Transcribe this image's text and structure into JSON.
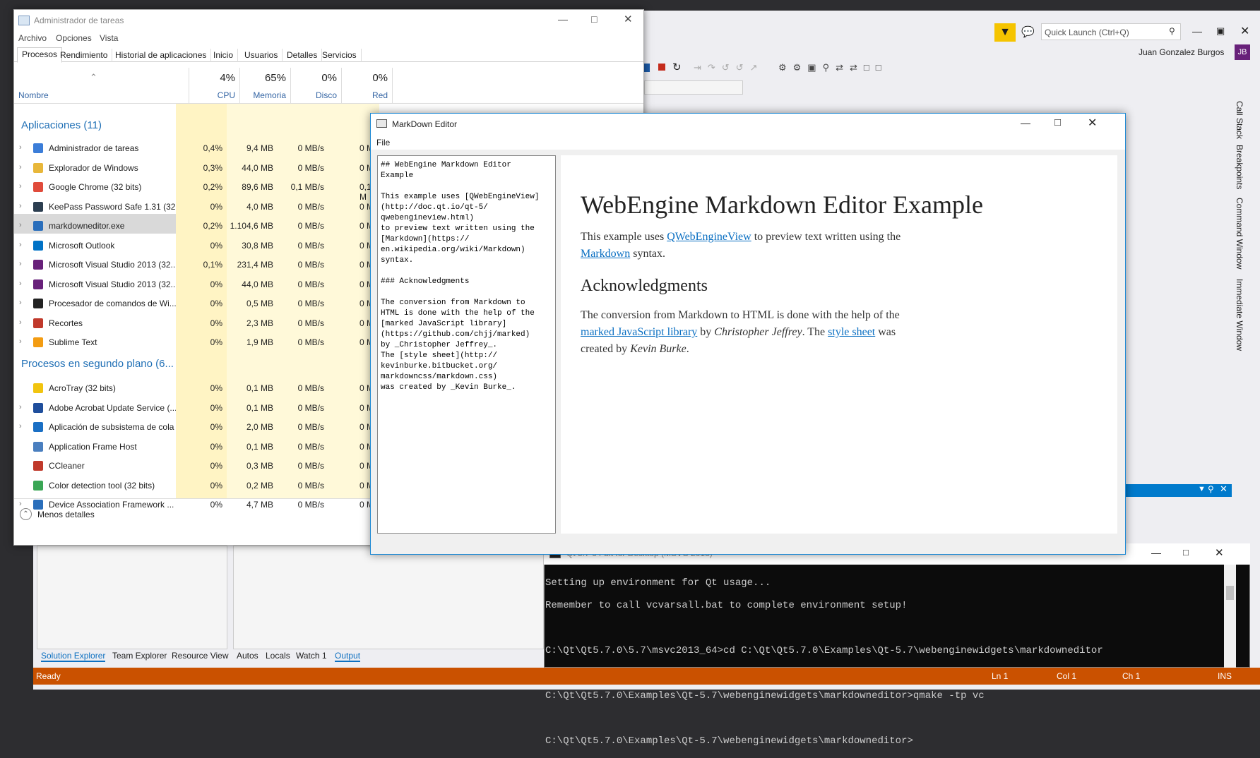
{
  "vs": {
    "quick_launch_placeholder": "Quick Launch (Ctrl+Q)",
    "user_name": "Juan Gonzalez Burgos",
    "user_initials": "JB",
    "right_tabs": [
      "Call Stack",
      "Breakpoints",
      "Command Window",
      "Immediate Window"
    ],
    "bottom_tabs_left": [
      "Solution Explorer",
      "Team Explorer",
      "Resource View"
    ],
    "bottom_tabs_right": [
      "Autos",
      "Locals",
      "Watch 1",
      "Output"
    ],
    "status": {
      "ready": "Ready",
      "ln": "Ln 1",
      "col": "Col 1",
      "ch": "Ch 1",
      "ins": "INS"
    },
    "colors": {
      "status_bar": "#ca5100",
      "accent": "#007acc",
      "filter_icon": "#f5c400",
      "avatar": "#68217a"
    }
  },
  "task_manager": {
    "title": "Administrador de tareas",
    "menu": [
      "Archivo",
      "Opciones",
      "Vista"
    ],
    "tabs": [
      "Procesos",
      "Rendimiento",
      "Historial de aplicaciones",
      "Inicio",
      "Usuarios",
      "Detalles",
      "Servicios"
    ],
    "columns": {
      "name": "Nombre",
      "cpu_pct": "4%",
      "cpu": "CPU",
      "mem_pct": "65%",
      "mem": "Memoria",
      "disk_pct": "0%",
      "disk": "Disco",
      "net_pct": "0%",
      "net": "Red"
    },
    "group_apps": "Aplicaciones (11)",
    "apps": [
      {
        "name": "Administrador de tareas",
        "cpu": "0,4%",
        "mem": "9,4 MB",
        "disk": "0 MB/s",
        "net": "0 M"
      },
      {
        "name": "Explorador de Windows",
        "cpu": "0,3%",
        "mem": "44,0 MB",
        "disk": "0 MB/s",
        "net": "0 M"
      },
      {
        "name": "Google Chrome (32 bits)",
        "cpu": "0,2%",
        "mem": "89,6 MB",
        "disk": "0,1 MB/s",
        "net": "0,1 M"
      },
      {
        "name": "KeePass Password Safe 1.31 (32 ...",
        "cpu": "0%",
        "mem": "4,0 MB",
        "disk": "0 MB/s",
        "net": "0 M"
      },
      {
        "name": "markdowneditor.exe",
        "cpu": "0,2%",
        "mem": "1.104,6 MB",
        "disk": "0 MB/s",
        "net": "0 M"
      },
      {
        "name": "Microsoft Outlook",
        "cpu": "0%",
        "mem": "30,8 MB",
        "disk": "0 MB/s",
        "net": "0 M"
      },
      {
        "name": "Microsoft Visual Studio 2013 (32...",
        "cpu": "0,1%",
        "mem": "231,4 MB",
        "disk": "0 MB/s",
        "net": "0 M"
      },
      {
        "name": "Microsoft Visual Studio 2013 (32...",
        "cpu": "0%",
        "mem": "44,0 MB",
        "disk": "0 MB/s",
        "net": "0 M"
      },
      {
        "name": "Procesador de comandos de Wi...",
        "cpu": "0%",
        "mem": "0,5 MB",
        "disk": "0 MB/s",
        "net": "0 M"
      },
      {
        "name": "Recortes",
        "cpu": "0%",
        "mem": "2,3 MB",
        "disk": "0 MB/s",
        "net": "0 M"
      },
      {
        "name": "Sublime Text",
        "cpu": "0%",
        "mem": "1,9 MB",
        "disk": "0 MB/s",
        "net": "0 M"
      }
    ],
    "group_bg": "Procesos en segundo plano (6...",
    "bg": [
      {
        "name": "AcroTray (32 bits)",
        "cpu": "0%",
        "mem": "0,1 MB",
        "disk": "0 MB/s",
        "net": "0 M"
      },
      {
        "name": "Adobe Acrobat Update Service (...",
        "cpu": "0%",
        "mem": "0,1 MB",
        "disk": "0 MB/s",
        "net": "0 M"
      },
      {
        "name": "Aplicación de subsistema de cola",
        "cpu": "0%",
        "mem": "2,0 MB",
        "disk": "0 MB/s",
        "net": "0 M"
      },
      {
        "name": "Application Frame Host",
        "cpu": "0%",
        "mem": "0,1 MB",
        "disk": "0 MB/s",
        "net": "0 M"
      },
      {
        "name": "CCleaner",
        "cpu": "0%",
        "mem": "0,3 MB",
        "disk": "0 MB/s",
        "net": "0 M"
      },
      {
        "name": "Color detection tool (32 bits)",
        "cpu": "0%",
        "mem": "0,2 MB",
        "disk": "0 MB/s",
        "net": "0 M"
      },
      {
        "name": "Device Association Framework ...",
        "cpu": "0%",
        "mem": "4,7 MB",
        "disk": "0 MB/s",
        "net": "0 M"
      }
    ],
    "fewer_details": "Menos detalles"
  },
  "markdown_editor": {
    "title": "MarkDown Editor",
    "menu_file": "File",
    "source": "## WebEngine Markdown Editor\nExample\n\nThis example uses [QWebEngineView]\n(http://doc.qt.io/qt-5/\nqwebengineview.html)\nto preview text written using the\n[Markdown](https://\nen.wikipedia.org/wiki/Markdown)\nsyntax.\n\n### Acknowledgments\n\nThe conversion from Markdown to\nHTML is done with the help of the\n[marked JavaScript library]\n(https://github.com/chjj/marked)\nby _Christopher Jeffrey_.\nThe [style sheet](http://\nkevinburke.bitbucket.org/\nmarkdowncss/markdown.css)\nwas created by _Kevin Burke_.",
    "preview": {
      "h1": "WebEngine Markdown Editor Example",
      "p1_a": "This example uses ",
      "p1_link1": "QWebEngineView",
      "p1_b": " to preview text written using the",
      "p1_link2": "Markdown",
      "p1_c": " syntax.",
      "h2": "Acknowledgments",
      "p2_a": "The conversion from Markdown to HTML is done with the help of the",
      "p2_link1": "marked JavaScript library",
      "p2_b": " by ",
      "p2_em1": "Christopher Jeffrey",
      "p2_c": ". The ",
      "p2_link2": "style sheet",
      "p2_d": " was",
      "p2_e": "created by ",
      "p2_em2": "Kevin Burke",
      "p2_f": "."
    }
  },
  "console": {
    "title": "Qt 5.7 64-bit for Desktop (MSVC 2013)",
    "lines": [
      "Setting up environment for Qt usage...",
      "Remember to call vcvarsall.bat to complete environment setup!",
      "",
      "C:\\Qt\\Qt5.7.0\\5.7\\msvc2013_64>cd C:\\Qt\\Qt5.7.0\\Examples\\Qt-5.7\\webenginewidgets\\markdowneditor",
      "",
      "C:\\Qt\\Qt5.7.0\\Examples\\Qt-5.7\\webenginewidgets\\markdowneditor>qmake -tp vc",
      "",
      "C:\\Qt\\Qt5.7.0\\Examples\\Qt-5.7\\webenginewidgets\\markdowneditor>"
    ]
  }
}
